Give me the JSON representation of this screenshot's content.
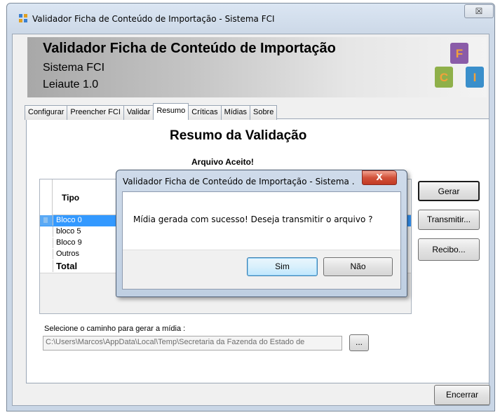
{
  "window": {
    "title": "Validador Ficha de Conteúdo de Importação - Sistema FCI",
    "close_symbol": "☒"
  },
  "header": {
    "title": "Validador Ficha de Conteúdo de Importação",
    "subtitle1": "Sistema FCI",
    "subtitle2": "Leiaute 1.0",
    "logo": {
      "letters": [
        "F",
        "C",
        "I"
      ],
      "colors": [
        "#8a5ca8",
        "#8fb04a",
        "#3a8fcb"
      ]
    }
  },
  "tabs": [
    {
      "label": "Configurar"
    },
    {
      "label": "Preencher FCI"
    },
    {
      "label": "Validar"
    },
    {
      "label": "Resumo",
      "active": true
    },
    {
      "label": "Críticas"
    },
    {
      "label": "Mídias"
    },
    {
      "label": "Sobre"
    }
  ],
  "resumo": {
    "title": "Resumo da Validação",
    "status": "Arquivo Aceito!"
  },
  "grid": {
    "column_header": "Tipo",
    "rows": [
      "Bloco 0",
      "bloco 5",
      "Bloco 9",
      "Outros",
      "Total"
    ],
    "selected_row": "Bloco 0"
  },
  "buttons": {
    "gerar": "Gerar",
    "transmitir": "Transmitir...",
    "recibo": "Recibo...",
    "browse": "...",
    "encerrar": "Encerrar"
  },
  "path": {
    "label": "Selecione o caminho para gerar a mídia :",
    "value": "C:\\Users\\Marcos\\AppData\\Local\\Temp\\Secretaria da Fazenda do Estado de"
  },
  "dialog": {
    "title": "Validador Ficha de Conteúdo de Importação - Sistema ...",
    "close_symbol": "X",
    "message": "Mídia gerada com sucesso! Deseja transmitir o arquivo ?",
    "yes": "Sim",
    "no": "Não"
  }
}
